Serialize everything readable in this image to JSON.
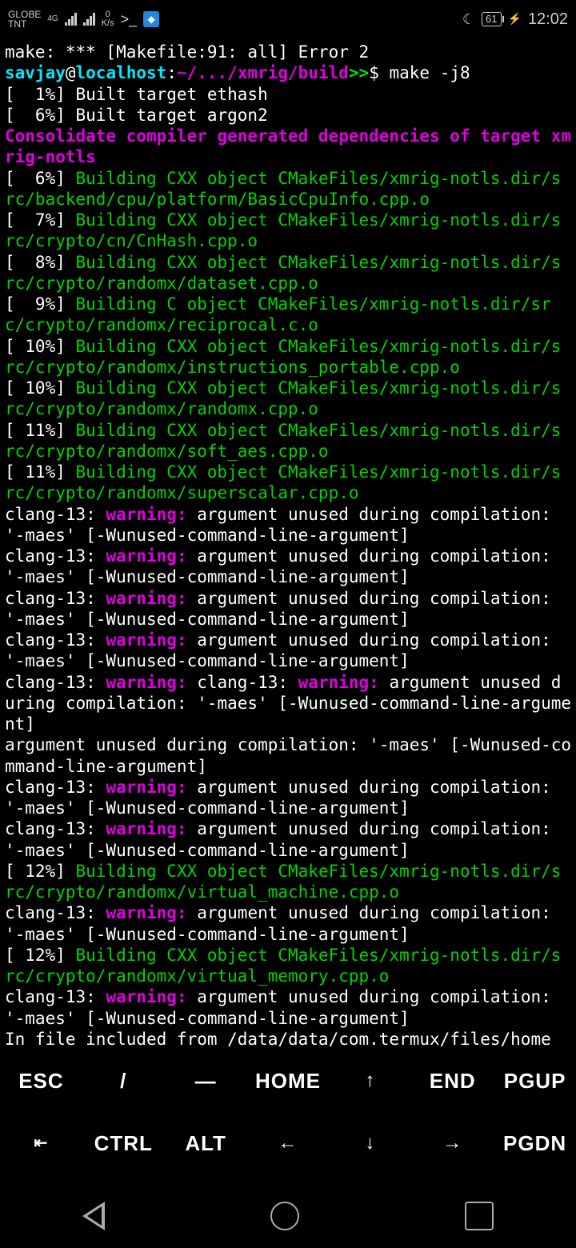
{
  "status": {
    "carrier1": "GLOBE",
    "carrier2": "TNT",
    "net_type": "4G",
    "speed_value": "0",
    "speed_unit": "K/s",
    "battery": "61",
    "time": "12:02"
  },
  "prompt": {
    "user": "savjay",
    "at": "@",
    "host": "localhost",
    "colon": ":",
    "path": "~/.../xmrig/build",
    "arrows": ">>",
    "dollar": "$ ",
    "command": "make -j8"
  },
  "lines": [
    {
      "segs": [
        {
          "c": "white",
          "t": "make: *** [Makefile:91: all] Error 2"
        }
      ]
    },
    {
      "prompt": true
    },
    {
      "segs": [
        {
          "c": "white",
          "t": "[  1%] Built target ethash"
        }
      ]
    },
    {
      "segs": [
        {
          "c": "white",
          "t": "[  6%] Built target argon2"
        }
      ]
    },
    {
      "segs": [
        {
          "c": "magenta",
          "t": "Consolidate compiler generated dependencies of target xmrig-notls"
        }
      ]
    },
    {
      "segs": [
        {
          "c": "white",
          "t": "[  6%] "
        },
        {
          "c": "green",
          "t": "Building CXX object CMakeFiles/xmrig-notls.dir/src/backend/cpu/platform/BasicCpuInfo.cpp.o"
        }
      ]
    },
    {
      "segs": [
        {
          "c": "white",
          "t": "[  7%] "
        },
        {
          "c": "green",
          "t": "Building CXX object CMakeFiles/xmrig-notls.dir/src/crypto/cn/CnHash.cpp.o"
        }
      ]
    },
    {
      "segs": [
        {
          "c": "white",
          "t": "[  8%] "
        },
        {
          "c": "green",
          "t": "Building CXX object CMakeFiles/xmrig-notls.dir/src/crypto/randomx/dataset.cpp.o"
        }
      ]
    },
    {
      "segs": [
        {
          "c": "white",
          "t": "[  9%] "
        },
        {
          "c": "green",
          "t": "Building C object CMakeFiles/xmrig-notls.dir/src/crypto/randomx/reciprocal.c.o"
        }
      ]
    },
    {
      "segs": [
        {
          "c": "white",
          "t": "[ 10%] "
        },
        {
          "c": "green",
          "t": "Building CXX object CMakeFiles/xmrig-notls.dir/src/crypto/randomx/instructions_portable.cpp.o"
        }
      ]
    },
    {
      "segs": [
        {
          "c": "white",
          "t": "[ 10%] "
        },
        {
          "c": "green",
          "t": "Building CXX object CMakeFiles/xmrig-notls.dir/src/crypto/randomx/randomx.cpp.o"
        }
      ]
    },
    {
      "segs": [
        {
          "c": "white",
          "t": "[ 11%] "
        },
        {
          "c": "green",
          "t": "Building CXX object CMakeFiles/xmrig-notls.dir/src/crypto/randomx/soft_aes.cpp.o"
        }
      ]
    },
    {
      "segs": [
        {
          "c": "white",
          "t": "[ 11%] "
        },
        {
          "c": "green",
          "t": "Building CXX object CMakeFiles/xmrig-notls.dir/src/crypto/randomx/superscalar.cpp.o"
        }
      ]
    },
    {
      "segs": [
        {
          "c": "white",
          "t": "clang-13: "
        },
        {
          "c": "magentaw",
          "t": "warning: "
        },
        {
          "c": "white",
          "t": "argument unused during compilation: '-maes' [-Wunused-command-line-argument]"
        }
      ]
    },
    {
      "segs": [
        {
          "c": "white",
          "t": "clang-13: "
        },
        {
          "c": "magentaw",
          "t": "warning: "
        },
        {
          "c": "white",
          "t": "argument unused during compilation: '-maes' [-Wunused-command-line-argument]"
        }
      ]
    },
    {
      "segs": [
        {
          "c": "white",
          "t": "clang-13: "
        },
        {
          "c": "magentaw",
          "t": "warning: "
        },
        {
          "c": "white",
          "t": "argument unused during compilation: '-maes' [-Wunused-command-line-argument]"
        }
      ]
    },
    {
      "segs": [
        {
          "c": "white",
          "t": "clang-13: "
        },
        {
          "c": "magentaw",
          "t": "warning: "
        },
        {
          "c": "white",
          "t": "argument unused during compilation: '-maes' [-Wunused-command-line-argument]"
        }
      ]
    },
    {
      "segs": [
        {
          "c": "white",
          "t": "clang-13: "
        },
        {
          "c": "magentaw",
          "t": "warning: "
        },
        {
          "c": "white",
          "t": "clang-13: "
        },
        {
          "c": "magentaw",
          "t": "warning: "
        },
        {
          "c": "white",
          "t": "argument unused during compilation: '-maes' [-Wunused-command-line-argument]"
        }
      ]
    },
    {
      "segs": [
        {
          "c": "white",
          "t": "argument unused during compilation: '-maes' [-Wunused-command-line-argument]"
        }
      ]
    },
    {
      "segs": [
        {
          "c": "white",
          "t": "clang-13: "
        },
        {
          "c": "magentaw",
          "t": "warning: "
        },
        {
          "c": "white",
          "t": "argument unused during compilation: '-maes' [-Wunused-command-line-argument]"
        }
      ]
    },
    {
      "segs": [
        {
          "c": "white",
          "t": "clang-13: "
        },
        {
          "c": "magentaw",
          "t": "warning: "
        },
        {
          "c": "white",
          "t": "argument unused during compilation: '-maes' [-Wunused-command-line-argument]"
        }
      ]
    },
    {
      "segs": [
        {
          "c": "white",
          "t": "[ 12%] "
        },
        {
          "c": "green",
          "t": "Building CXX object CMakeFiles/xmrig-notls.dir/src/crypto/randomx/virtual_machine.cpp.o"
        }
      ]
    },
    {
      "segs": [
        {
          "c": "white",
          "t": "clang-13: "
        },
        {
          "c": "magentaw",
          "t": "warning: "
        },
        {
          "c": "white",
          "t": "argument unused during compilation: '-maes' [-Wunused-command-line-argument]"
        }
      ]
    },
    {
      "segs": [
        {
          "c": "white",
          "t": "[ 12%] "
        },
        {
          "c": "green",
          "t": "Building CXX object CMakeFiles/xmrig-notls.dir/src/crypto/randomx/virtual_memory.cpp.o"
        }
      ]
    },
    {
      "segs": [
        {
          "c": "white",
          "t": "clang-13: "
        },
        {
          "c": "magentaw",
          "t": "warning: "
        },
        {
          "c": "white",
          "t": "argument unused during compilation: '-maes' [-Wunused-command-line-argument]"
        }
      ]
    },
    {
      "segs": [
        {
          "c": "white",
          "t": "In file included from /data/data/com.termux/files/home"
        }
      ]
    }
  ],
  "keys": {
    "esc": "ESC",
    "slash": "/",
    "dash": "—",
    "home": "HOME",
    "up": "↑",
    "end": "END",
    "pgup": "PGUP",
    "tab": "⇤",
    "ctrl": "CTRL",
    "alt": "ALT",
    "left": "←",
    "down": "↓",
    "right": "→",
    "pgdn": "PGDN"
  }
}
